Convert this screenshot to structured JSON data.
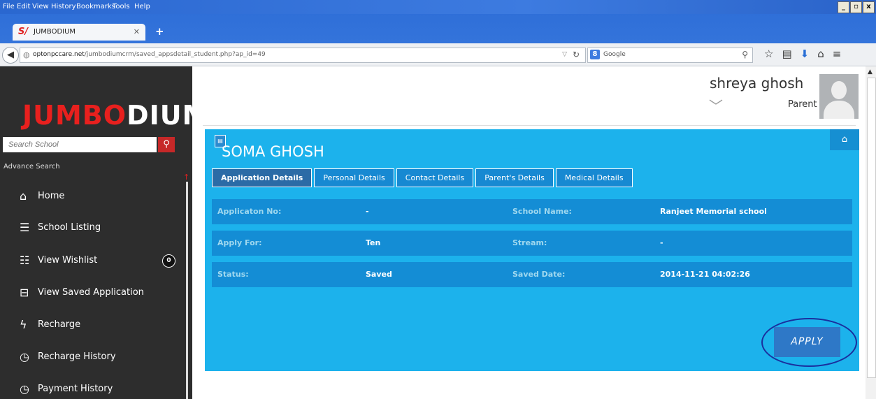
{
  "browser": {
    "menu": [
      "File",
      "Edit",
      "View",
      "History",
      "Bookmarks",
      "Tools",
      "Help"
    ],
    "window_buttons": [
      "_",
      "▫",
      "x"
    ],
    "tab_title": "JUMBODIUM",
    "url_host": "optonpccare.net",
    "url_path": "/jumbodiumcrm/saved_appsdetail_student.php?ap_id=49",
    "search_engine": "Google"
  },
  "sidebar": {
    "logo_part1": "JUMBO",
    "logo_part2": "DIUM",
    "search_placeholder": "Search School",
    "advance_search": "Advance Search",
    "items": [
      {
        "label": "Home",
        "icon": "home-icon"
      },
      {
        "label": "School Listing",
        "icon": "list-icon"
      },
      {
        "label": "View Wishlist",
        "icon": "wishlist-icon"
      },
      {
        "label": "View Saved Application",
        "icon": "drive-icon"
      },
      {
        "label": "Recharge",
        "icon": "bolt-icon"
      },
      {
        "label": "Recharge History",
        "icon": "clock-icon"
      },
      {
        "label": "Payment History",
        "icon": "clock-icon"
      }
    ],
    "wishlist_count": "0"
  },
  "user": {
    "name": "shreya ghosh",
    "role": "Parent"
  },
  "panel": {
    "student_name": "SOMA GHOSH",
    "tabs": [
      "Application Details",
      "Personal Details",
      "Contact Details",
      "Parent's Details",
      "Medical Details"
    ],
    "rows": [
      {
        "label1": "Applicaton No:",
        "value1": "-",
        "label2": "School Name:",
        "value2": "Ranjeet Memorial school"
      },
      {
        "label1": "Apply For:",
        "value1": "Ten",
        "label2": "Stream:",
        "value2": "-"
      },
      {
        "label1": "Status:",
        "value1": "Saved",
        "label2": "Saved Date:",
        "value2": "2014-11-21 04:02:26"
      }
    ],
    "apply_label": "APPLY"
  },
  "colors": {
    "panel": "#1cb2ec",
    "row": "#148dd5",
    "sidebar": "#2d2d2d",
    "accent_red": "#c62828"
  }
}
